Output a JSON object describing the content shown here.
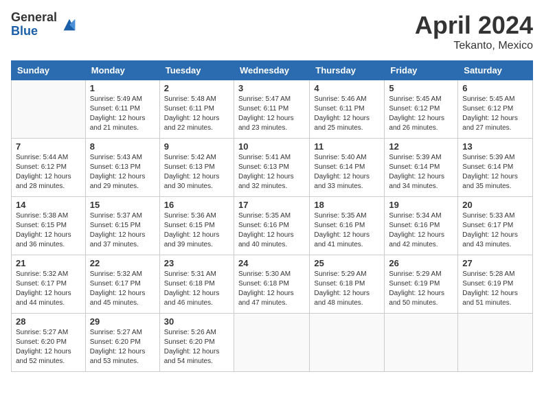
{
  "header": {
    "logo": {
      "general": "General",
      "blue": "Blue"
    },
    "title": "April 2024",
    "location": "Tekanto, Mexico"
  },
  "calendar": {
    "days_of_week": [
      "Sunday",
      "Monday",
      "Tuesday",
      "Wednesday",
      "Thursday",
      "Friday",
      "Saturday"
    ],
    "weeks": [
      [
        {
          "day": "",
          "sunrise": "",
          "sunset": "",
          "daylight": ""
        },
        {
          "day": "1",
          "sunrise": "Sunrise: 5:49 AM",
          "sunset": "Sunset: 6:11 PM",
          "daylight": "Daylight: 12 hours and 21 minutes."
        },
        {
          "day": "2",
          "sunrise": "Sunrise: 5:48 AM",
          "sunset": "Sunset: 6:11 PM",
          "daylight": "Daylight: 12 hours and 22 minutes."
        },
        {
          "day": "3",
          "sunrise": "Sunrise: 5:47 AM",
          "sunset": "Sunset: 6:11 PM",
          "daylight": "Daylight: 12 hours and 23 minutes."
        },
        {
          "day": "4",
          "sunrise": "Sunrise: 5:46 AM",
          "sunset": "Sunset: 6:11 PM",
          "daylight": "Daylight: 12 hours and 25 minutes."
        },
        {
          "day": "5",
          "sunrise": "Sunrise: 5:45 AM",
          "sunset": "Sunset: 6:12 PM",
          "daylight": "Daylight: 12 hours and 26 minutes."
        },
        {
          "day": "6",
          "sunrise": "Sunrise: 5:45 AM",
          "sunset": "Sunset: 6:12 PM",
          "daylight": "Daylight: 12 hours and 27 minutes."
        }
      ],
      [
        {
          "day": "7",
          "sunrise": "Sunrise: 5:44 AM",
          "sunset": "Sunset: 6:12 PM",
          "daylight": "Daylight: 12 hours and 28 minutes."
        },
        {
          "day": "8",
          "sunrise": "Sunrise: 5:43 AM",
          "sunset": "Sunset: 6:13 PM",
          "daylight": "Daylight: 12 hours and 29 minutes."
        },
        {
          "day": "9",
          "sunrise": "Sunrise: 5:42 AM",
          "sunset": "Sunset: 6:13 PM",
          "daylight": "Daylight: 12 hours and 30 minutes."
        },
        {
          "day": "10",
          "sunrise": "Sunrise: 5:41 AM",
          "sunset": "Sunset: 6:13 PM",
          "daylight": "Daylight: 12 hours and 32 minutes."
        },
        {
          "day": "11",
          "sunrise": "Sunrise: 5:40 AM",
          "sunset": "Sunset: 6:14 PM",
          "daylight": "Daylight: 12 hours and 33 minutes."
        },
        {
          "day": "12",
          "sunrise": "Sunrise: 5:39 AM",
          "sunset": "Sunset: 6:14 PM",
          "daylight": "Daylight: 12 hours and 34 minutes."
        },
        {
          "day": "13",
          "sunrise": "Sunrise: 5:39 AM",
          "sunset": "Sunset: 6:14 PM",
          "daylight": "Daylight: 12 hours and 35 minutes."
        }
      ],
      [
        {
          "day": "14",
          "sunrise": "Sunrise: 5:38 AM",
          "sunset": "Sunset: 6:15 PM",
          "daylight": "Daylight: 12 hours and 36 minutes."
        },
        {
          "day": "15",
          "sunrise": "Sunrise: 5:37 AM",
          "sunset": "Sunset: 6:15 PM",
          "daylight": "Daylight: 12 hours and 37 minutes."
        },
        {
          "day": "16",
          "sunrise": "Sunrise: 5:36 AM",
          "sunset": "Sunset: 6:15 PM",
          "daylight": "Daylight: 12 hours and 39 minutes."
        },
        {
          "day": "17",
          "sunrise": "Sunrise: 5:35 AM",
          "sunset": "Sunset: 6:16 PM",
          "daylight": "Daylight: 12 hours and 40 minutes."
        },
        {
          "day": "18",
          "sunrise": "Sunrise: 5:35 AM",
          "sunset": "Sunset: 6:16 PM",
          "daylight": "Daylight: 12 hours and 41 minutes."
        },
        {
          "day": "19",
          "sunrise": "Sunrise: 5:34 AM",
          "sunset": "Sunset: 6:16 PM",
          "daylight": "Daylight: 12 hours and 42 minutes."
        },
        {
          "day": "20",
          "sunrise": "Sunrise: 5:33 AM",
          "sunset": "Sunset: 6:17 PM",
          "daylight": "Daylight: 12 hours and 43 minutes."
        }
      ],
      [
        {
          "day": "21",
          "sunrise": "Sunrise: 5:32 AM",
          "sunset": "Sunset: 6:17 PM",
          "daylight": "Daylight: 12 hours and 44 minutes."
        },
        {
          "day": "22",
          "sunrise": "Sunrise: 5:32 AM",
          "sunset": "Sunset: 6:17 PM",
          "daylight": "Daylight: 12 hours and 45 minutes."
        },
        {
          "day": "23",
          "sunrise": "Sunrise: 5:31 AM",
          "sunset": "Sunset: 6:18 PM",
          "daylight": "Daylight: 12 hours and 46 minutes."
        },
        {
          "day": "24",
          "sunrise": "Sunrise: 5:30 AM",
          "sunset": "Sunset: 6:18 PM",
          "daylight": "Daylight: 12 hours and 47 minutes."
        },
        {
          "day": "25",
          "sunrise": "Sunrise: 5:29 AM",
          "sunset": "Sunset: 6:18 PM",
          "daylight": "Daylight: 12 hours and 48 minutes."
        },
        {
          "day": "26",
          "sunrise": "Sunrise: 5:29 AM",
          "sunset": "Sunset: 6:19 PM",
          "daylight": "Daylight: 12 hours and 50 minutes."
        },
        {
          "day": "27",
          "sunrise": "Sunrise: 5:28 AM",
          "sunset": "Sunset: 6:19 PM",
          "daylight": "Daylight: 12 hours and 51 minutes."
        }
      ],
      [
        {
          "day": "28",
          "sunrise": "Sunrise: 5:27 AM",
          "sunset": "Sunset: 6:20 PM",
          "daylight": "Daylight: 12 hours and 52 minutes."
        },
        {
          "day": "29",
          "sunrise": "Sunrise: 5:27 AM",
          "sunset": "Sunset: 6:20 PM",
          "daylight": "Daylight: 12 hours and 53 minutes."
        },
        {
          "day": "30",
          "sunrise": "Sunrise: 5:26 AM",
          "sunset": "Sunset: 6:20 PM",
          "daylight": "Daylight: 12 hours and 54 minutes."
        },
        {
          "day": "",
          "sunrise": "",
          "sunset": "",
          "daylight": ""
        },
        {
          "day": "",
          "sunrise": "",
          "sunset": "",
          "daylight": ""
        },
        {
          "day": "",
          "sunrise": "",
          "sunset": "",
          "daylight": ""
        },
        {
          "day": "",
          "sunrise": "",
          "sunset": "",
          "daylight": ""
        }
      ]
    ]
  }
}
